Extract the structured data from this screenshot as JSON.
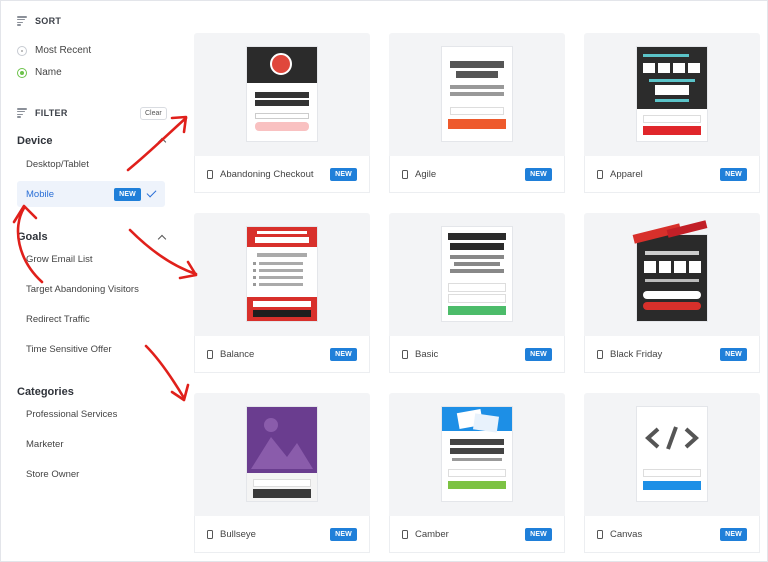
{
  "sort": {
    "title": "SORT",
    "options": [
      {
        "label": "Most Recent",
        "selected": false
      },
      {
        "label": "Name",
        "selected": true
      }
    ]
  },
  "filter": {
    "title": "FILTER",
    "clear_label": "Clear"
  },
  "device": {
    "title": "Device",
    "items": [
      "Desktop/Tablet",
      "Mobile"
    ],
    "selected_badge": "NEW"
  },
  "goals": {
    "title": "Goals",
    "items": [
      "Grow Email List",
      "Target Abandoning Visitors",
      "Redirect Traffic",
      "Time Sensitive Offer"
    ]
  },
  "categories": {
    "title": "Categories",
    "items": [
      "Professional Services",
      "Marketer",
      "Store Owner"
    ]
  },
  "templates": [
    {
      "name": "Abandoning Checkout",
      "badge": "NEW"
    },
    {
      "name": "Agile",
      "badge": "NEW"
    },
    {
      "name": "Apparel",
      "badge": "NEW"
    },
    {
      "name": "Balance",
      "badge": "NEW"
    },
    {
      "name": "Basic",
      "badge": "NEW"
    },
    {
      "name": "Black Friday",
      "badge": "NEW"
    },
    {
      "name": "Bullseye",
      "badge": "NEW"
    },
    {
      "name": "Camber",
      "badge": "NEW"
    },
    {
      "name": "Canvas",
      "badge": "NEW"
    }
  ],
  "colors": {
    "accent": "#1f7fd9",
    "selected_radio": "#6cc24a",
    "annotation_arrow": "#e0201b"
  }
}
